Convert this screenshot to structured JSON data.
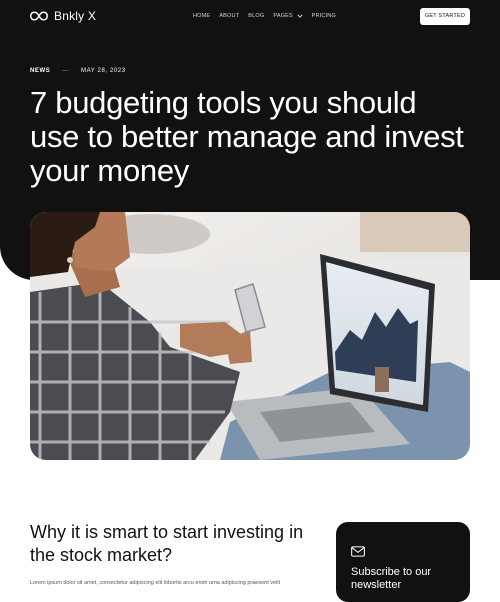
{
  "brand": {
    "name": "Bnkly X",
    "logo_icon": "infinity-logo-icon"
  },
  "nav": {
    "items": [
      {
        "label": "HOME"
      },
      {
        "label": "ABOUT"
      },
      {
        "label": "BLOG"
      },
      {
        "label": "PAGES",
        "has_dropdown": true
      },
      {
        "label": "PRICING"
      }
    ],
    "cta_label": "GET STARTED"
  },
  "article": {
    "category": "NEWS",
    "separator": "—",
    "date": "MAY 28, 2023",
    "title": "7 budgeting tools you should use to better manage and invest your money",
    "hero_image": "woman-with-phone-and-laptop-photo",
    "section_title": "Why it is smart to start investing in the stock market?",
    "body_excerpt": "Lorem ipsum dolor sit amet, consectetur adipiscing elit lobortis arcu enim urna adipiscing praesent velit"
  },
  "sidebar": {
    "subscribe_icon": "mail-icon",
    "subscribe_title": "Subscribe to our newsletter"
  },
  "colors": {
    "dark": "#111111",
    "light": "#ffffff"
  }
}
